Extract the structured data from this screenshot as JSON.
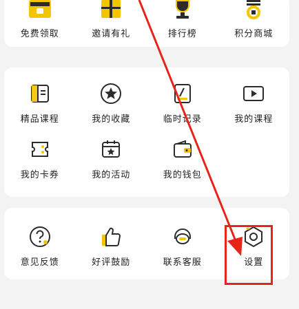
{
  "top_row": [
    {
      "label": "免费领取",
      "icon": "gift-box-icon"
    },
    {
      "label": "邀请有礼",
      "icon": "invite-gift-icon"
    },
    {
      "label": "排行榜",
      "icon": "trophy-icon"
    },
    {
      "label": "积分商城",
      "icon": "coin-mall-icon"
    }
  ],
  "services": {
    "row1": [
      {
        "label": "精品课程",
        "icon": "course-book-icon"
      },
      {
        "label": "我的收藏",
        "icon": "star-circle-icon"
      },
      {
        "label": "临时记录",
        "icon": "edit-note-icon"
      },
      {
        "label": "我的课程",
        "icon": "play-button-icon"
      }
    ],
    "row2": [
      {
        "label": "我的卡券",
        "icon": "coupon-ticket-icon"
      },
      {
        "label": "我的活动",
        "icon": "calendar-star-icon"
      },
      {
        "label": "我的钱包",
        "icon": "wallet-icon"
      }
    ]
  },
  "tools": [
    {
      "label": "意见反馈",
      "icon": "feedback-question-icon"
    },
    {
      "label": "好评鼓励",
      "icon": "thumbs-up-icon"
    },
    {
      "label": "联系客服",
      "icon": "customer-service-icon"
    },
    {
      "label": "设置",
      "icon": "settings-gear-icon"
    }
  ],
  "colors": {
    "accent": "#f5c400",
    "icon_dark": "#2b2b2b",
    "annotation": "#e8231a"
  }
}
